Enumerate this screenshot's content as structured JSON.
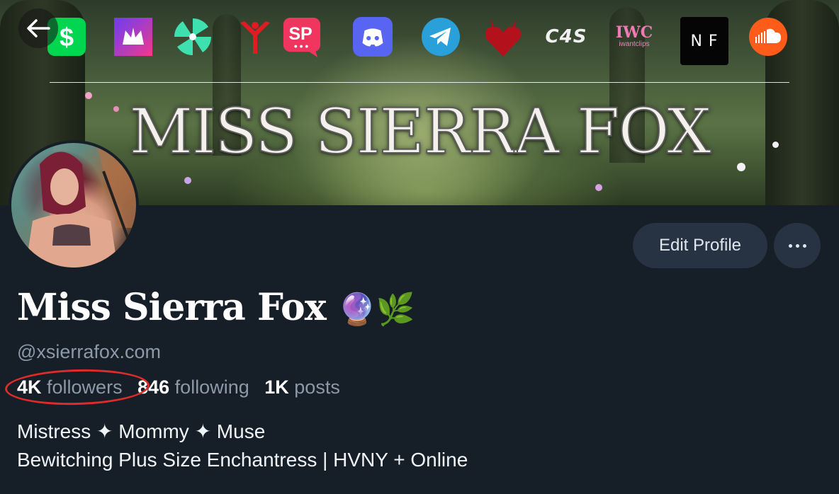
{
  "banner": {
    "title": "MISS SIERRA FOX",
    "icons": [
      "cash-app-icon",
      "crown-app-icon",
      "pinwheel-app-icon",
      "red-figure-icon",
      "sp-app-icon",
      "discord-icon",
      "telegram-icon",
      "devil-heart-icon",
      "c4s-icon",
      "iwc-icon",
      "nf-icon",
      "soundcloud-icon"
    ],
    "c4s_label": "C4S",
    "iwc_label": "IWC",
    "iwc_sub": "iwantclips",
    "nf_label": "N F",
    "sp_label": "SP"
  },
  "actions": {
    "edit_profile": "Edit Profile",
    "more": "More options"
  },
  "profile": {
    "name": "Miss Sierra Fox",
    "name_emoji": "🔮🌿",
    "handle": "@xsierrafox.com",
    "followers_count": "4K",
    "followers_label": "followers",
    "following_count": "846",
    "following_label": "following",
    "posts_count": "1K",
    "posts_label": "posts",
    "bio_line1": "Mistress ✦ Mommy ✦ Muse",
    "bio_line2": "Bewitching Plus Size Enchantress | HVNY + Online"
  },
  "colors": {
    "background": "#161e27",
    "button": "#273342",
    "annotation": "#e02b2b"
  }
}
